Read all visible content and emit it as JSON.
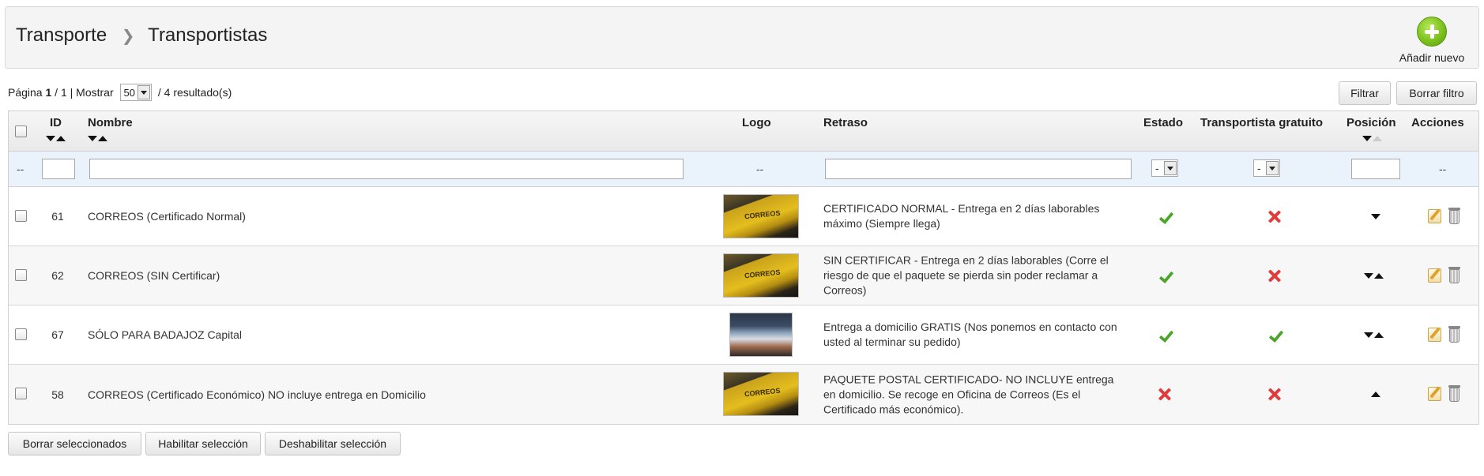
{
  "breadcrumb": {
    "parent": "Transporte",
    "current": "Transportistas"
  },
  "toolbar": {
    "add_new_label": "Añadir nuevo"
  },
  "pagination": {
    "prefix": "Página ",
    "page": "1",
    "of": " / 1 | Mostrar ",
    "per_page": "50",
    "results": " / 4 resultado(s)"
  },
  "filters": {
    "filter_button": "Filtrar",
    "clear_button": "Borrar filtro"
  },
  "columns": {
    "id": "ID",
    "nombre": "Nombre",
    "logo": "Logo",
    "retraso": "Retraso",
    "estado": "Estado",
    "gratuito": "Transportista gratuito",
    "posicion": "Posición",
    "acciones": "Acciones"
  },
  "filter_row": {
    "bulk_placeholder": "--",
    "logo_placeholder": "--",
    "estado_value": "-",
    "gratuito_value": "-",
    "acciones_placeholder": "--"
  },
  "rows": [
    {
      "id": "61",
      "nombre": "CORREOS (Certificado Normal)",
      "logo": "truck-logo",
      "retraso_lines": [
        "CERTIFICADO NORMAL - Entrega en 2 días laborables",
        "máximo (Siempre llega)"
      ],
      "estado": true,
      "gratuito": false,
      "positions": [
        "down"
      ]
    },
    {
      "id": "62",
      "nombre": "CORREOS (SIN Certificar)",
      "logo": "truck-logo",
      "retraso_lines": [
        "SIN CERTIFICAR - Entrega en 2 días laborables (Corre el",
        "riesgo de que el paquete se pierda sin poder reclamar a",
        "Correos)"
      ],
      "estado": true,
      "gratuito": false,
      "positions": [
        "down",
        "up"
      ]
    },
    {
      "id": "67",
      "nombre": "SÓLO PARA BADAJOZ Capital",
      "logo": "storefront-logo",
      "retraso_lines": [
        "Entrega a domicilio GRATIS (Nos ponemos en contacto con",
        "usted al terminar su pedido)"
      ],
      "estado": true,
      "gratuito": true,
      "positions": [
        "down",
        "up"
      ]
    },
    {
      "id": "58",
      "nombre": "CORREOS (Certificado Económico) NO incluye entrega en Domicilio",
      "logo": "truck-logo",
      "retraso_lines": [
        "PAQUETE POSTAL CERTIFICADO- NO INCLUYE entrega",
        "en domicilio. Se recoge en Oficina de Correos (Es el",
        "Certificado más económico)."
      ],
      "estado": false,
      "gratuito": false,
      "positions": [
        "up"
      ]
    }
  ],
  "logo_texts": {
    "truck": "CORREOS"
  },
  "bulk_actions": {
    "delete": "Borrar seleccionados",
    "enable": "Habilitar selección",
    "disable": "Deshabilitar selección"
  },
  "colors": {
    "check": "#4aa52a",
    "cross": "#e23b3b",
    "add_button": "#7cc21d"
  }
}
